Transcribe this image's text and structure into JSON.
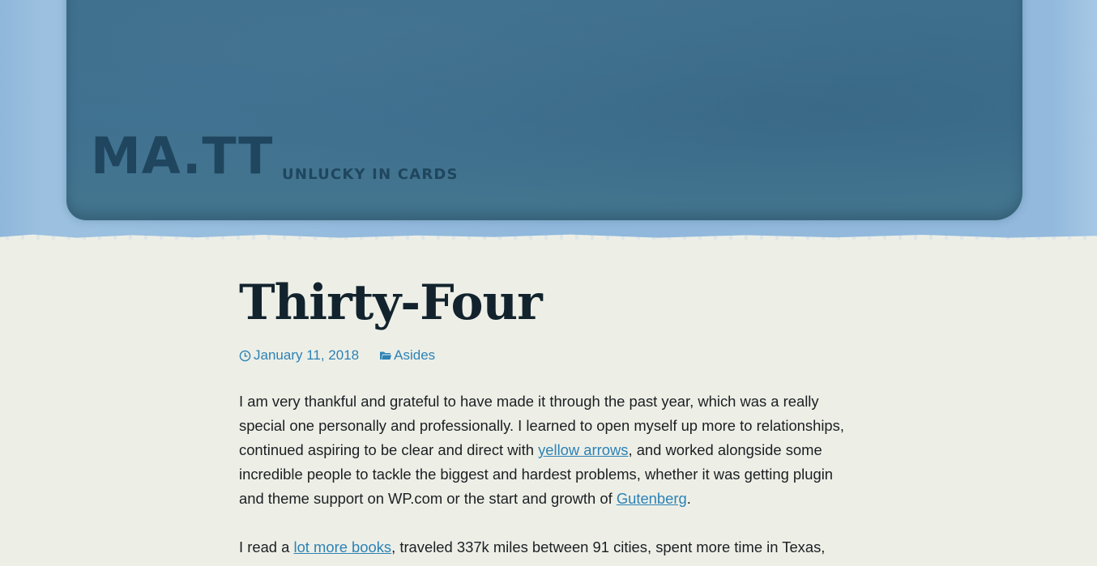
{
  "site": {
    "title": "MA.TT",
    "tagline": "UNLUCKY IN CARDS"
  },
  "post": {
    "title": "Thirty-Four",
    "date": "January 11, 2018",
    "category": "Asides",
    "p1": {
      "part1": "I am very thankful and grateful to have made it through the past year, which was a really special one personally and professionally. I learned to open myself up more to relation­ships, continued aspiring to be clear and direct with ",
      "link1": "yellow arrows",
      "part2": ", and worked alongside some incredible people to tackle the biggest and hardest problems, whether it was getting plugin and theme support on WP.com or the start and growth of ",
      "link2": "Gutenberg",
      "part3": "."
    },
    "p2": {
      "part1": "I read a ",
      "link1": "lot more books",
      "part2": ", traveled 337k miles between 91 cities, spent more time in Texas,"
    }
  },
  "icons": {
    "date": "clock-icon",
    "category": "folder-icon"
  },
  "colors": {
    "link": "#2d82b5",
    "title": "#12232d",
    "header_card": "#3f7190",
    "header_bg": "#92b9dc",
    "page_bg": "#edefe7"
  }
}
